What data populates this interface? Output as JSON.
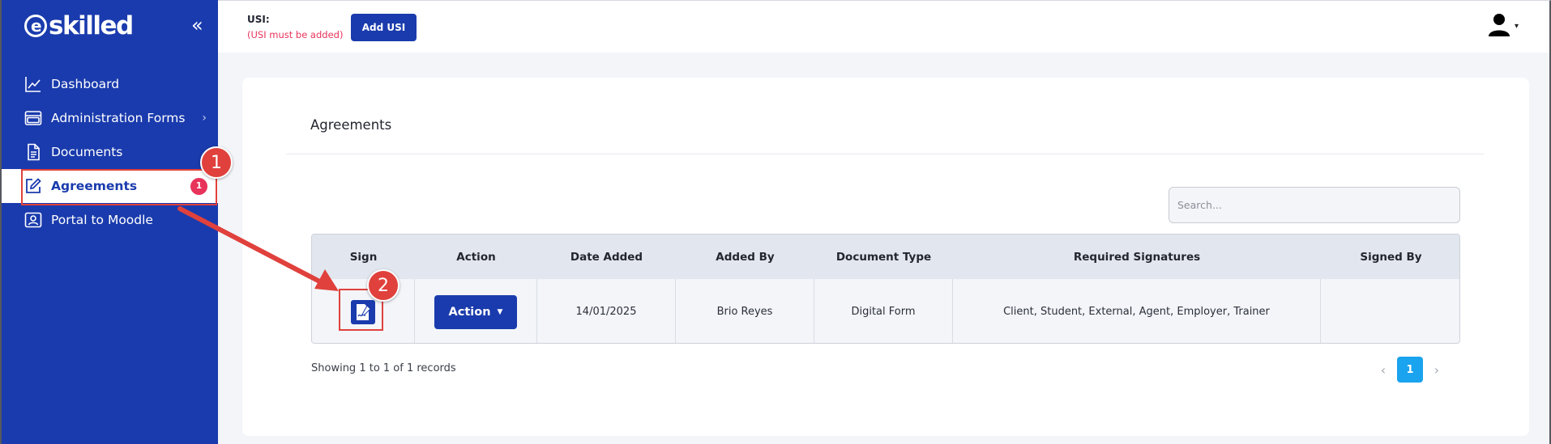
{
  "sidebar": {
    "logo_text": "skilled",
    "logo_e": "e",
    "collapse_icon": "«",
    "items": [
      {
        "label": "Dashboard",
        "icon": "chart-line-icon"
      },
      {
        "label": "Administration Forms",
        "icon": "window-stack-icon",
        "chevron": "›"
      },
      {
        "label": "Documents",
        "icon": "document-icon"
      },
      {
        "label": "Agreements",
        "icon": "pen-square-icon",
        "badge": "1",
        "active": true
      },
      {
        "label": "Portal to Moodle",
        "icon": "portrait-icon"
      }
    ]
  },
  "header": {
    "usi_label": "USI:",
    "usi_warning": "(USI must be added)",
    "add_usi_label": "Add USI",
    "user_icon": "user-icon",
    "caret": "▾"
  },
  "main": {
    "title": "Agreements",
    "search_placeholder": "Search...",
    "table": {
      "columns": [
        "Sign",
        "Action",
        "Date Added",
        "Added By",
        "Document Type",
        "Required Signatures",
        "Signed By"
      ],
      "rows": [
        {
          "sign_icon": "sign-document-icon",
          "action_label": "Action",
          "date_added": "14/01/2025",
          "added_by": "Brio Reyes",
          "document_type": "Digital Form",
          "required_signatures": "Client, Student, External, Agent, Employer, Trainer",
          "signed_by": ""
        }
      ]
    },
    "showing_text": "Showing 1 to 1 of 1 records",
    "pagination": {
      "prev": "‹",
      "current": "1",
      "next": "›"
    }
  },
  "annotations": {
    "step1": "1",
    "step2": "2",
    "color": "#e0413c"
  },
  "colors": {
    "brand": "#1a3bad",
    "badge": "#e8335a",
    "pager_active": "#1aa3ee"
  }
}
